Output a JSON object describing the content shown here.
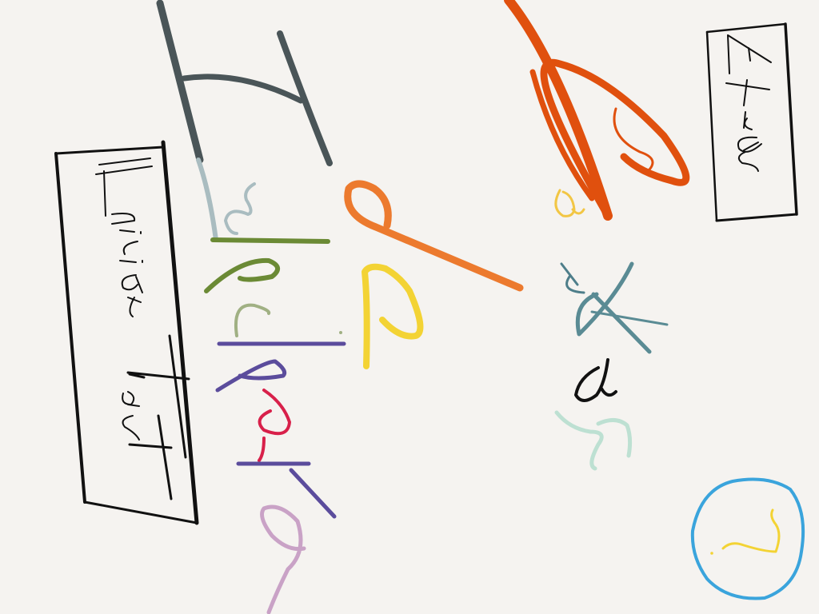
{
  "buttons": {
    "back_label": "Atrás",
    "start_label": "Iniciar Test",
    "help_label": "?"
  },
  "title": {
    "line1": "Letras",
    "line2": "de",
    "line3": "Ishihara"
  },
  "colors": {
    "background": "#f5f3f0",
    "ink_black": "#111111",
    "ink_gray": "#4a5558",
    "ink_gray_light": "#a9bcc0",
    "orange_dark": "#e0500e",
    "orange": "#ec7a2e",
    "yellow": "#f3d334",
    "yellow_soft": "#f2c644",
    "teal": "#5a8b94",
    "mint": "#bde0d2",
    "green": "#6b8a35",
    "sage": "#a0b083",
    "purple": "#5b4c9c",
    "crimson": "#d8204a",
    "mauve": "#c9a2c6",
    "blue": "#3aa4dc"
  },
  "icons": {
    "help": "question-circle-icon"
  }
}
